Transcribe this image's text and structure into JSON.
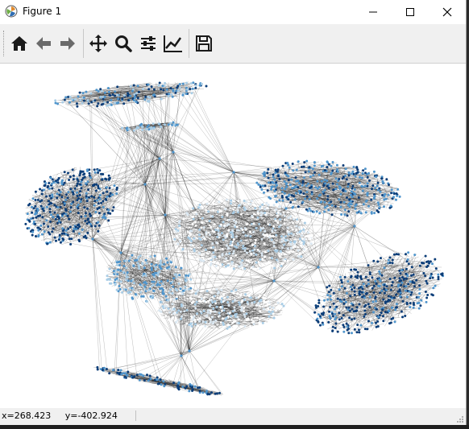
{
  "window": {
    "title": "Figure 1",
    "controls": {
      "minimize": "minimize",
      "maximize": "maximize",
      "close": "close"
    }
  },
  "toolbar": {
    "buttons": [
      {
        "name": "home",
        "icon": "home-icon"
      },
      {
        "name": "back",
        "icon": "arrow-left-icon"
      },
      {
        "name": "forward",
        "icon": "arrow-right-icon"
      },
      {
        "name": "pan",
        "icon": "move-icon"
      },
      {
        "name": "zoom",
        "icon": "magnifier-icon"
      },
      {
        "name": "configure-subplots",
        "icon": "sliders-icon"
      },
      {
        "name": "edit-axis",
        "icon": "line-chart-icon"
      },
      {
        "name": "save",
        "icon": "floppy-disk-icon"
      }
    ]
  },
  "status": {
    "x": "x=268.423",
    "y": "y=-402.924"
  },
  "colors": {
    "dark_node": "#0b3d78",
    "mid_node": "#4f95cc",
    "light_node": "#a9cde6",
    "pale_node": "#dbe8f2",
    "edge": "#000000"
  }
}
